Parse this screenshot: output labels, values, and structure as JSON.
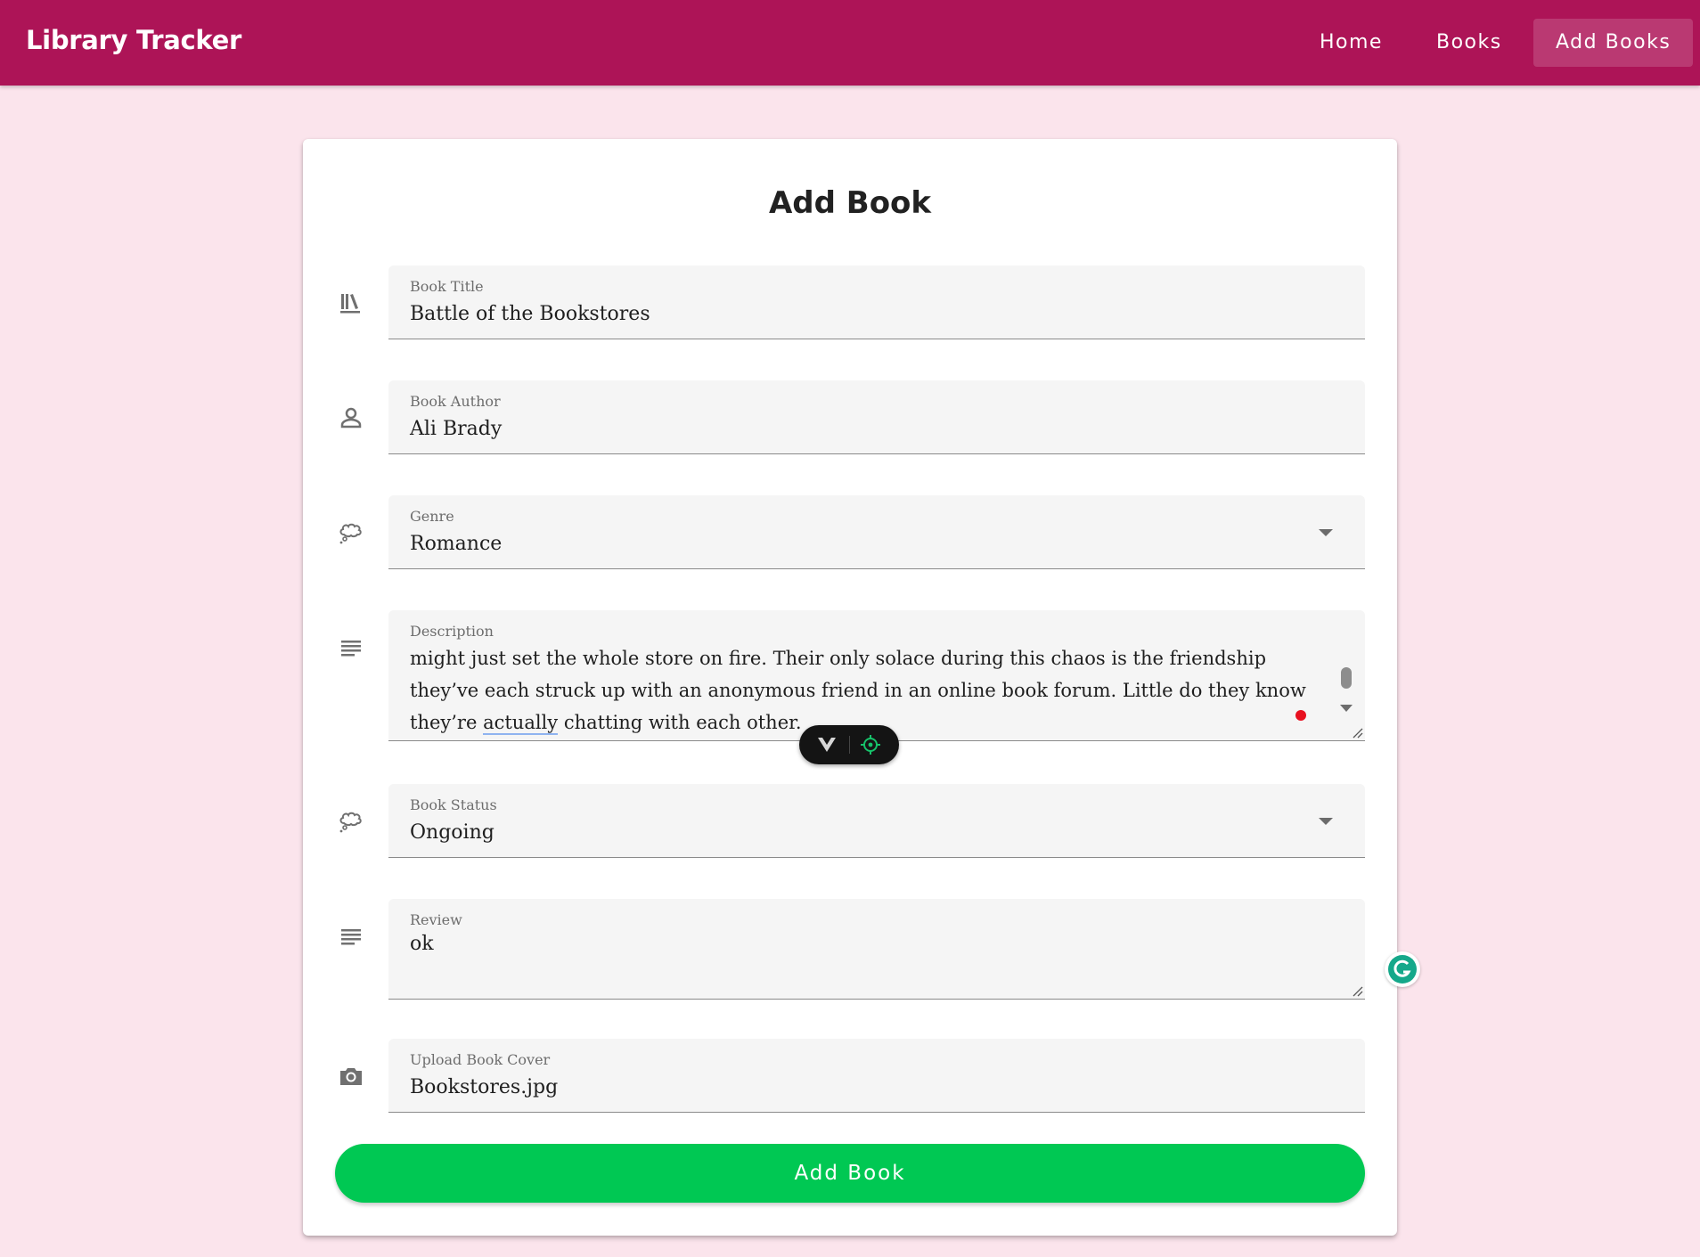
{
  "app": {
    "title": "Library Tracker"
  },
  "nav": {
    "items": [
      {
        "label": "Home",
        "active": false
      },
      {
        "label": "Books",
        "active": false
      },
      {
        "label": "Add Books",
        "active": true
      }
    ]
  },
  "form": {
    "title": "Add Book",
    "fields": {
      "title": {
        "label": "Book Title",
        "value": "Battle of the Bookstores",
        "icon": "library-books-icon"
      },
      "author": {
        "label": "Book Author",
        "value": "Ali Brady",
        "icon": "person-icon"
      },
      "genre": {
        "label": "Genre",
        "value": "Romance",
        "icon": "thought-bubble-icon"
      },
      "description": {
        "label": "Description",
        "text_before": "might just set the whole store on fire. Their only solace during this chaos is the friendship they’ve each struck up with an anonymous friend in an online book forum. Little do they know they’re ",
        "text_spell": "actually",
        "text_after": " chatting with each other.",
        "icon": "notes-icon"
      },
      "status": {
        "label": "Book Status",
        "value": "Ongoing",
        "icon": "thought-bubble-icon"
      },
      "review": {
        "label": "Review",
        "value": "ok",
        "icon": "notes-icon"
      },
      "cover": {
        "label": "Upload Book Cover",
        "value": "Bookstores.jpg",
        "icon": "camera-icon"
      }
    },
    "submit_label": "Add Book"
  },
  "colors": {
    "appbar": "#ad1457",
    "background": "#fbe4ec",
    "submit": "#00c853"
  }
}
